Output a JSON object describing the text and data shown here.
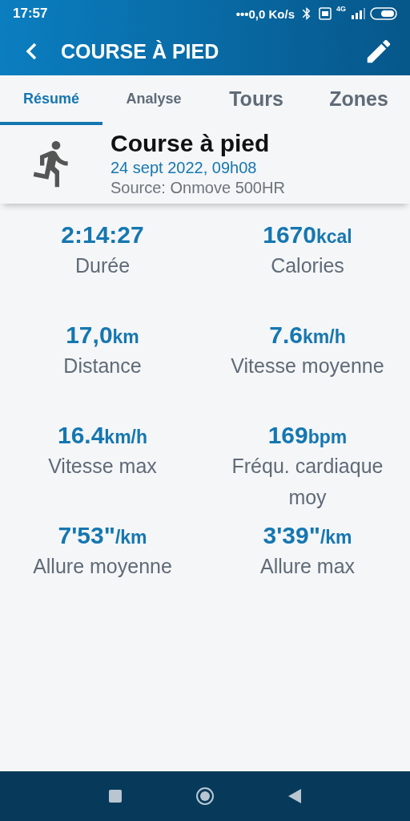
{
  "status_bar": {
    "time": "17:57",
    "network_speed": "•••0,0 Ko/s",
    "signal_label": "4G"
  },
  "header": {
    "title": "COURSE À PIED"
  },
  "tabs": [
    {
      "label": "Résumé",
      "selected": true
    },
    {
      "label": "Analyse",
      "selected": false
    },
    {
      "label": "Tours",
      "selected": false
    },
    {
      "label": "Zones",
      "selected": false
    }
  ],
  "activity": {
    "title": "Course à pied",
    "date": "24 sept 2022, 09h08",
    "source": "Source: Onmove 500HR"
  },
  "stats": [
    {
      "value": "2:14:27",
      "label": "Durée"
    },
    {
      "value": "1670",
      "unit": "kcal",
      "label": "Calories"
    },
    {
      "value": "17,0",
      "unit": "km",
      "label": "Distance"
    },
    {
      "value": "7.6",
      "unit": "km/h",
      "label": "Vitesse moyenne"
    },
    {
      "value": "16.4",
      "unit": "km/h",
      "label": "Vitesse max"
    },
    {
      "value": "169",
      "unit": "bpm",
      "label": "Fréqu. cardiaque moy"
    },
    {
      "value": "7'53\"",
      "unit": "/km",
      "label": "Allure moyenne"
    },
    {
      "value": "3'39\"",
      "unit": "/km",
      "label": "Allure max"
    }
  ]
}
